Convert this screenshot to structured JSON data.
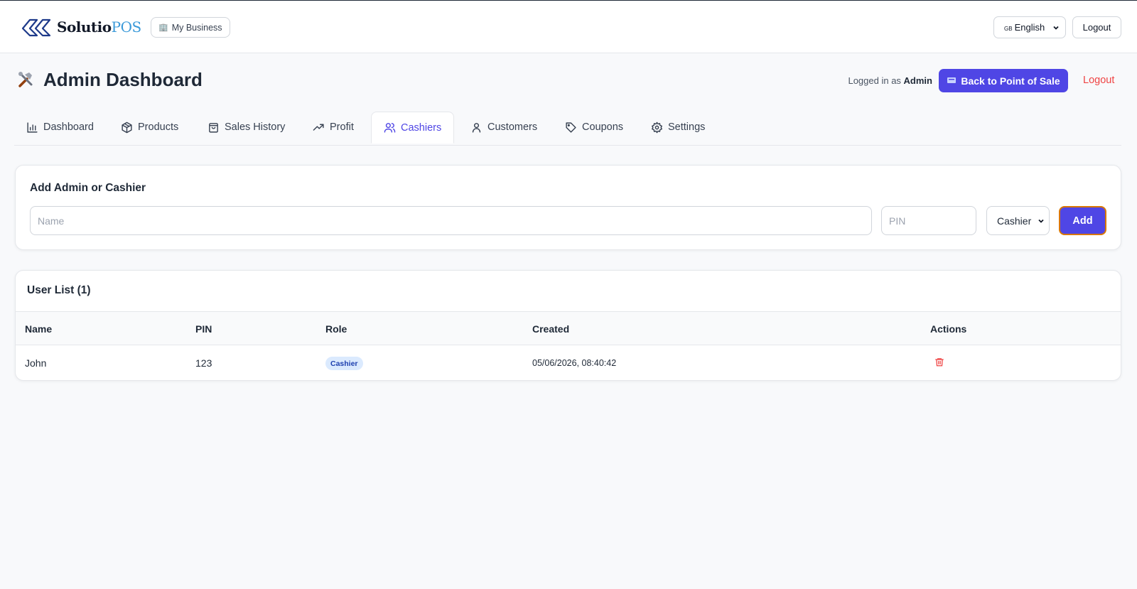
{
  "topbar": {
    "logo_main": "Solutio",
    "logo_accent": "POS",
    "business_button": "My Business",
    "language_flag": "GB",
    "language": "English",
    "logout": "Logout"
  },
  "header": {
    "title": "Admin Dashboard",
    "logged_in_prefix": "Logged in as",
    "logged_in_user": "Admin",
    "back_button": "Back to Point of Sale",
    "logout": "Logout"
  },
  "tabs": [
    {
      "label": "Dashboard",
      "icon": "bar-chart-icon"
    },
    {
      "label": "Products",
      "icon": "box-icon"
    },
    {
      "label": "Sales History",
      "icon": "shopping-bag-icon"
    },
    {
      "label": "Profit",
      "icon": "trending-up-icon"
    },
    {
      "label": "Cashiers",
      "icon": "users-icon",
      "active": true
    },
    {
      "label": "Customers",
      "icon": "user-icon"
    },
    {
      "label": "Coupons",
      "icon": "tag-icon"
    },
    {
      "label": "Settings",
      "icon": "gear-icon"
    }
  ],
  "add_form": {
    "title": "Add Admin or Cashier",
    "name_placeholder": "Name",
    "pin_placeholder": "PIN",
    "role_selected": "Cashier",
    "add_button": "Add"
  },
  "user_list": {
    "title": "User List (1)",
    "columns": [
      "Name",
      "PIN",
      "Role",
      "Created",
      "Actions"
    ],
    "rows": [
      {
        "name": "John",
        "pin": "123",
        "role": "Cashier",
        "created": "05/06/2026, 08:40:42"
      }
    ]
  },
  "colors": {
    "accent": "#4f46e5",
    "danger": "#ef4444",
    "logo_accent": "#3b9ad9",
    "badge_bg": "#dbeafe"
  }
}
